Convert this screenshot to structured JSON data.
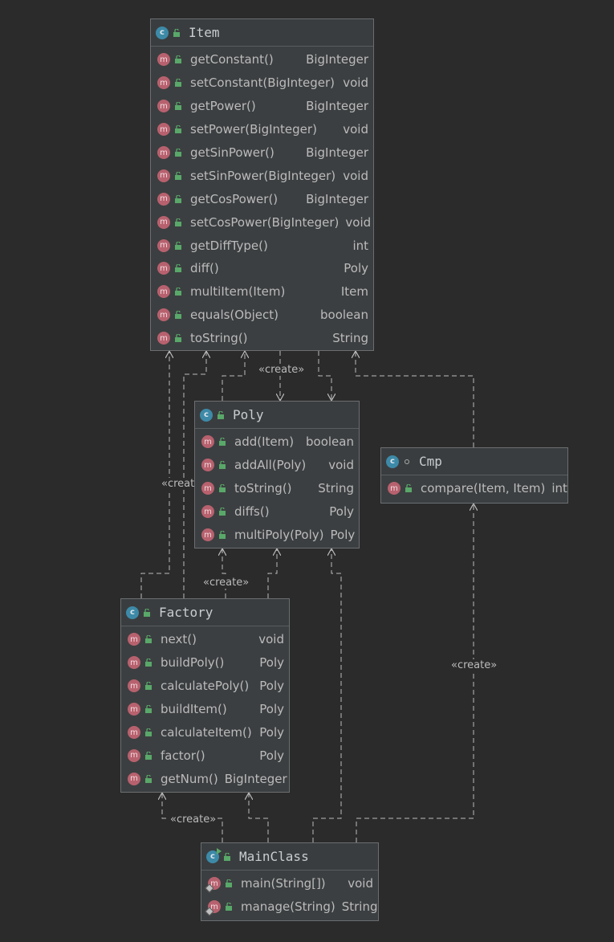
{
  "diagram": {
    "stereotype_label": "«create»",
    "icons": {
      "class_letter": "c",
      "method_letter": "m"
    },
    "colors": {
      "background": "#2b2b2b",
      "class_fill": "#3c3f41",
      "class_icon": "#3d8aa8",
      "method_icon": "#b8616e",
      "public_lock": "#59a869",
      "edge": "#bbbbbb"
    },
    "classes": {
      "item": {
        "name": "Item",
        "members": [
          {
            "sig": "getConstant()",
            "type": "BigInteger"
          },
          {
            "sig": "setConstant(BigInteger)",
            "type": "void"
          },
          {
            "sig": "getPower()",
            "type": "BigInteger"
          },
          {
            "sig": "setPower(BigInteger)",
            "type": "void"
          },
          {
            "sig": "getSinPower()",
            "type": "BigInteger"
          },
          {
            "sig": "setSinPower(BigInteger)",
            "type": "void"
          },
          {
            "sig": "getCosPower()",
            "type": "BigInteger"
          },
          {
            "sig": "setCosPower(BigInteger)",
            "type": "void"
          },
          {
            "sig": "getDiffType()",
            "type": "int"
          },
          {
            "sig": "diff()",
            "type": "Poly"
          },
          {
            "sig": "multiItem(Item)",
            "type": "Item"
          },
          {
            "sig": "equals(Object)",
            "type": "boolean"
          },
          {
            "sig": "toString()",
            "type": "String"
          }
        ]
      },
      "poly": {
        "name": "Poly",
        "members": [
          {
            "sig": "add(Item)",
            "type": "boolean"
          },
          {
            "sig": "addAll(Poly)",
            "type": "void"
          },
          {
            "sig": "toString()",
            "type": "String"
          },
          {
            "sig": "diffs()",
            "type": "Poly"
          },
          {
            "sig": "multiPoly(Poly)",
            "type": "Poly"
          }
        ]
      },
      "cmp": {
        "name": "Cmp",
        "members": [
          {
            "sig": "compare(Item, Item)",
            "type": "int"
          }
        ]
      },
      "factory": {
        "name": "Factory",
        "members": [
          {
            "sig": "next()",
            "type": "void"
          },
          {
            "sig": "buildPoly()",
            "type": "Poly"
          },
          {
            "sig": "calculatePoly()",
            "type": "Poly"
          },
          {
            "sig": "buildItem()",
            "type": "Poly"
          },
          {
            "sig": "calculateItem()",
            "type": "Poly"
          },
          {
            "sig": "factor()",
            "type": "Poly"
          },
          {
            "sig": "getNum()",
            "type": "BigInteger"
          }
        ]
      },
      "mainclass": {
        "name": "MainClass",
        "members": [
          {
            "sig": "main(String[])",
            "type": "void"
          },
          {
            "sig": "manage(String)",
            "type": "String"
          }
        ]
      }
    }
  }
}
